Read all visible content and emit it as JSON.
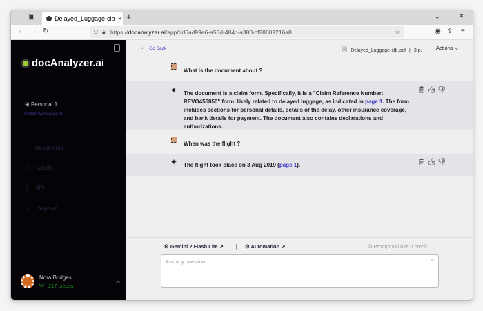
{
  "browser": {
    "tab_title": "Delayed_Luggage-clb.pdf",
    "url_prefix": "https://",
    "url_domain": "docanalyzer.ai",
    "url_path": "/app/t/d6ad99e6-a53d-484c-a380-cf28609216a8"
  },
  "sidebar": {
    "logo": "docAnalyzer.ai",
    "workspace": "Personal 1",
    "switch_workspace": "Switch Workspace",
    "items": [
      {
        "label": "Documents"
      },
      {
        "label": "Labels"
      },
      {
        "label": "API"
      },
      {
        "label": "Support"
      }
    ],
    "user": {
      "name": "Nora Bridges",
      "credits": "217 credits"
    }
  },
  "header": {
    "go_back": "Go Back",
    "file_name": "Delayed_Luggage-clb.pdf",
    "pages": "3 p.",
    "actions": "Actions"
  },
  "chat": [
    {
      "role": "user",
      "text": "What is the document about ?"
    },
    {
      "role": "assistant",
      "text_before": "The document is a claim form. Specifically, it is a \"Claim Reference Number: REVO456850\" form, likely related to delayed luggage, as indicated in ",
      "link": "page 1",
      "text_after": ". The form includes sections for personal details, details of the delay, other insurance coverage, and bank details for payment. The document also contains declarations and authorizations."
    },
    {
      "role": "user",
      "text": "When was the flight ?"
    },
    {
      "role": "assistant",
      "text_before": "The flight took place on 3 Aug 2019 (",
      "link": "page 1",
      "text_after": ")."
    }
  ],
  "composer": {
    "model": "Gemini 2 Flash Lite ↗",
    "separator": "|",
    "automation": "Automation ↗",
    "credit_note": "Prompt will use 0 credit",
    "placeholder": "Ask any question"
  }
}
